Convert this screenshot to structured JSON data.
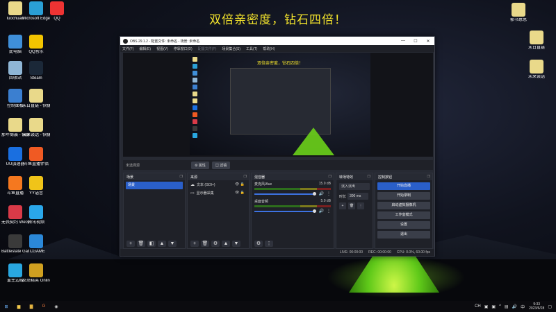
{
  "banner": "双倍亲密度，钻石四倍！",
  "desktop_icons_left": [
    {
      "label": "luochuan",
      "color": "#e9d98a"
    },
    {
      "label": "Microsoft Edge",
      "color": "#2a9fd6"
    },
    {
      "label": "QQ",
      "color": "#e33"
    },
    {
      "label": "此电脑",
      "color": "#3f8fd9"
    },
    {
      "label": "QQ音乐",
      "color": "#f2c400"
    },
    {
      "label": "回收站",
      "color": "#8fb6d6"
    },
    {
      "label": "Steam",
      "color": "#1b2838"
    },
    {
      "label": "控制面板",
      "color": "#3b7fd0"
    },
    {
      "label": "末日直链 - 快捷方式",
      "color": "#e9d98a"
    },
    {
      "label": "那年倚晨 - 快捷方式",
      "color": "#e9d98a"
    },
    {
      "label": "未来谈话 - 快捷方式",
      "color": "#e9d98a"
    },
    {
      "label": "UU加速器",
      "color": "#1a6fe0"
    },
    {
      "label": "斗鱼直播伴侣",
      "color": "#f05a23"
    },
    {
      "label": "斗鱼直播",
      "color": "#f5781f"
    },
    {
      "label": "YY语音",
      "color": "#f0c419"
    },
    {
      "label": "无畏契约 WeGame版",
      "color": "#d93a48"
    },
    {
      "label": "腾讯视频",
      "color": "#2aa7ea"
    },
    {
      "label": "Battlestate Games L...",
      "color": "#3a3a3a"
    },
    {
      "label": "TCGAME",
      "color": "#2b88d8"
    },
    {
      "label": "重生边缘",
      "color": "#29a7e0"
    },
    {
      "label": "反恐精英 Online",
      "color": "#d0a020"
    }
  ],
  "desktop_icons_right": [
    {
      "label": "郁书意思",
      "color": "#e9d98a"
    },
    {
      "label": "末日直链",
      "color": "#e9d98a"
    },
    {
      "label": "未来谈话",
      "color": "#e9d98a"
    }
  ],
  "obs": {
    "title": "OBS 29.1.2 - 配置文件: 未命名 - 场景: 未命名",
    "menu": [
      "文件(F)",
      "编辑(E)",
      "视图(V)",
      "停靠窗口(D)",
      "配置文件(P)",
      "场景集合(S)",
      "工具(T)",
      "帮助(H)"
    ],
    "scene_name": "未选择源",
    "scene_buttons": {
      "properties": "属性",
      "filters": "滤镜"
    },
    "docks": {
      "scenes": {
        "title": "场景",
        "items": [
          "场景"
        ]
      },
      "sources": {
        "title": "来源",
        "items": [
          {
            "icon": "audio-output-icon",
            "label": "文本 (GDI+)"
          },
          {
            "icon": "display-capture-icon",
            "label": "显示器采集"
          }
        ]
      },
      "mixer": {
        "title": "混音器",
        "tracks": [
          {
            "name": "麦克风/Aux",
            "db": "15.0 dB"
          },
          {
            "name": "桌面音频",
            "db": "5.0 dB"
          }
        ],
        "scale": [
          "-60",
          "-55",
          "-50",
          "-45",
          "-40",
          "-35",
          "-30",
          "-25",
          "-20",
          "-15",
          "-10",
          "-5",
          "0"
        ]
      },
      "transitions": {
        "title": "转场特效",
        "type": "淡入淡出",
        "duration_label": "时长",
        "duration": "300 ms"
      },
      "controls": {
        "title": "控制按钮",
        "buttons": [
          "开始直播",
          "开始录制",
          "启动虚拟摄像机",
          "工作室模式",
          "设置",
          "退出"
        ]
      }
    },
    "status": {
      "live": "LIVE: 00:00:00",
      "rec": "REC: 00:00:00",
      "cpu": "CPU: 0.0%, 60.00 fps"
    }
  },
  "taskbar": {
    "clock_time": "9:33",
    "clock_date": "2023/6/28",
    "lang": "CH"
  }
}
